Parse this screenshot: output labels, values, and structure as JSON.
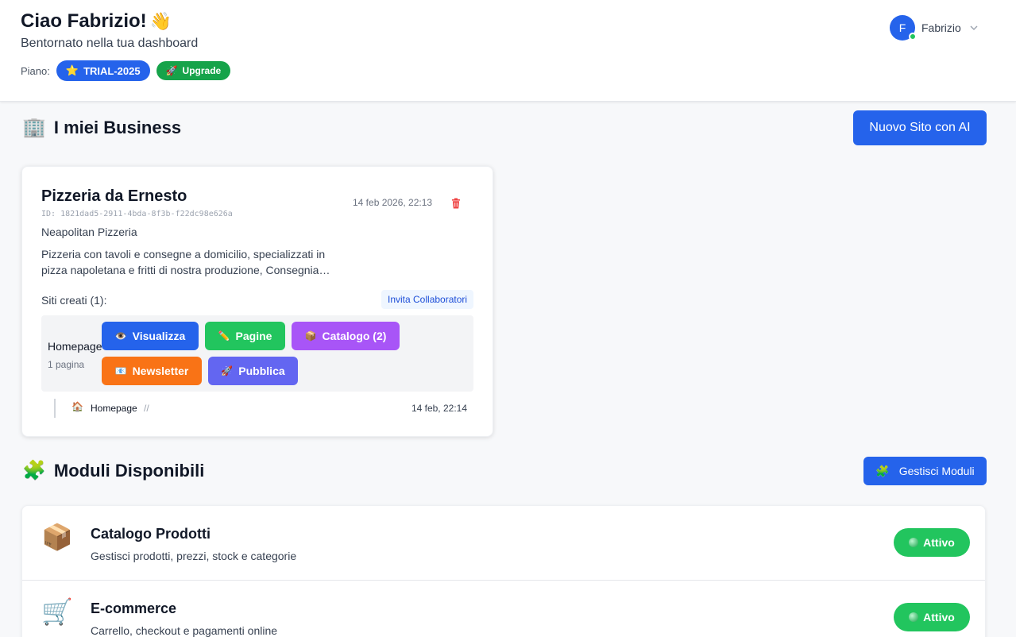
{
  "header": {
    "greeting": "Ciao Fabrizio!",
    "greeting_emoji": "👋",
    "subtitle": "Bentornato nella tua dashboard",
    "plan_label": "Piano:",
    "plan_icon": "⭐",
    "plan_name": "TRIAL-2025",
    "upgrade_icon": "🚀",
    "upgrade_label": "Upgrade",
    "user": {
      "initial": "F",
      "name": "Fabrizio"
    }
  },
  "business_section": {
    "icon": "🏢",
    "title": "I miei Business",
    "new_site_button": "Nuovo Sito con AI"
  },
  "business": {
    "name": "Pizzeria da Ernesto",
    "id": "ID: 1821dad5-2911-4bda-8f3b-f22dc98e626a",
    "date": "14 feb 2026, 22:13",
    "category": "Neapolitan Pizzeria",
    "description_line1": "Pizzeria con tavoli e consegne a domicilio, specializzati in",
    "description_line2": "pizza napoletana e fritti di nostra produzione, Consegniamo …",
    "sites_label": "Siti creati (1):",
    "invite_label": "Invita Collaboratori",
    "site": {
      "name": "Homepage",
      "pages": "1 pagina",
      "actions": {
        "view": {
          "icon": "👁️",
          "label": "Visualizza"
        },
        "pages": {
          "icon": "✏️",
          "label": "Pagine"
        },
        "catalog": {
          "icon": "📦",
          "label": "Catalogo (2)"
        },
        "newsletter": {
          "icon": "📧",
          "label": "Newsletter"
        },
        "publish": {
          "icon": "🚀",
          "label": "Pubblica"
        }
      },
      "page_row": {
        "icon": "🏠",
        "name": "Homepage",
        "path": "//",
        "date": "14 feb, 22:14"
      }
    }
  },
  "modules_section": {
    "icon": "🧩",
    "title": "Moduli Disponibili",
    "manage_icon": "🧩",
    "manage_button": "Gestisci Moduli",
    "modules": [
      {
        "icon": "📦",
        "title": "Catalogo Prodotti",
        "description": "Gestisci prodotti, prezzi, stock e categorie",
        "status": "Attivo"
      },
      {
        "icon": "🛒",
        "title": "E-commerce",
        "description": "Carrello, checkout e pagamenti online",
        "status": "Attivo"
      }
    ]
  },
  "colors": {
    "primary": "#2563eb",
    "success": "#22c55e",
    "purple": "#a855f7",
    "orange": "#f97316",
    "indigo": "#6366f1",
    "danger": "#ef4444"
  }
}
